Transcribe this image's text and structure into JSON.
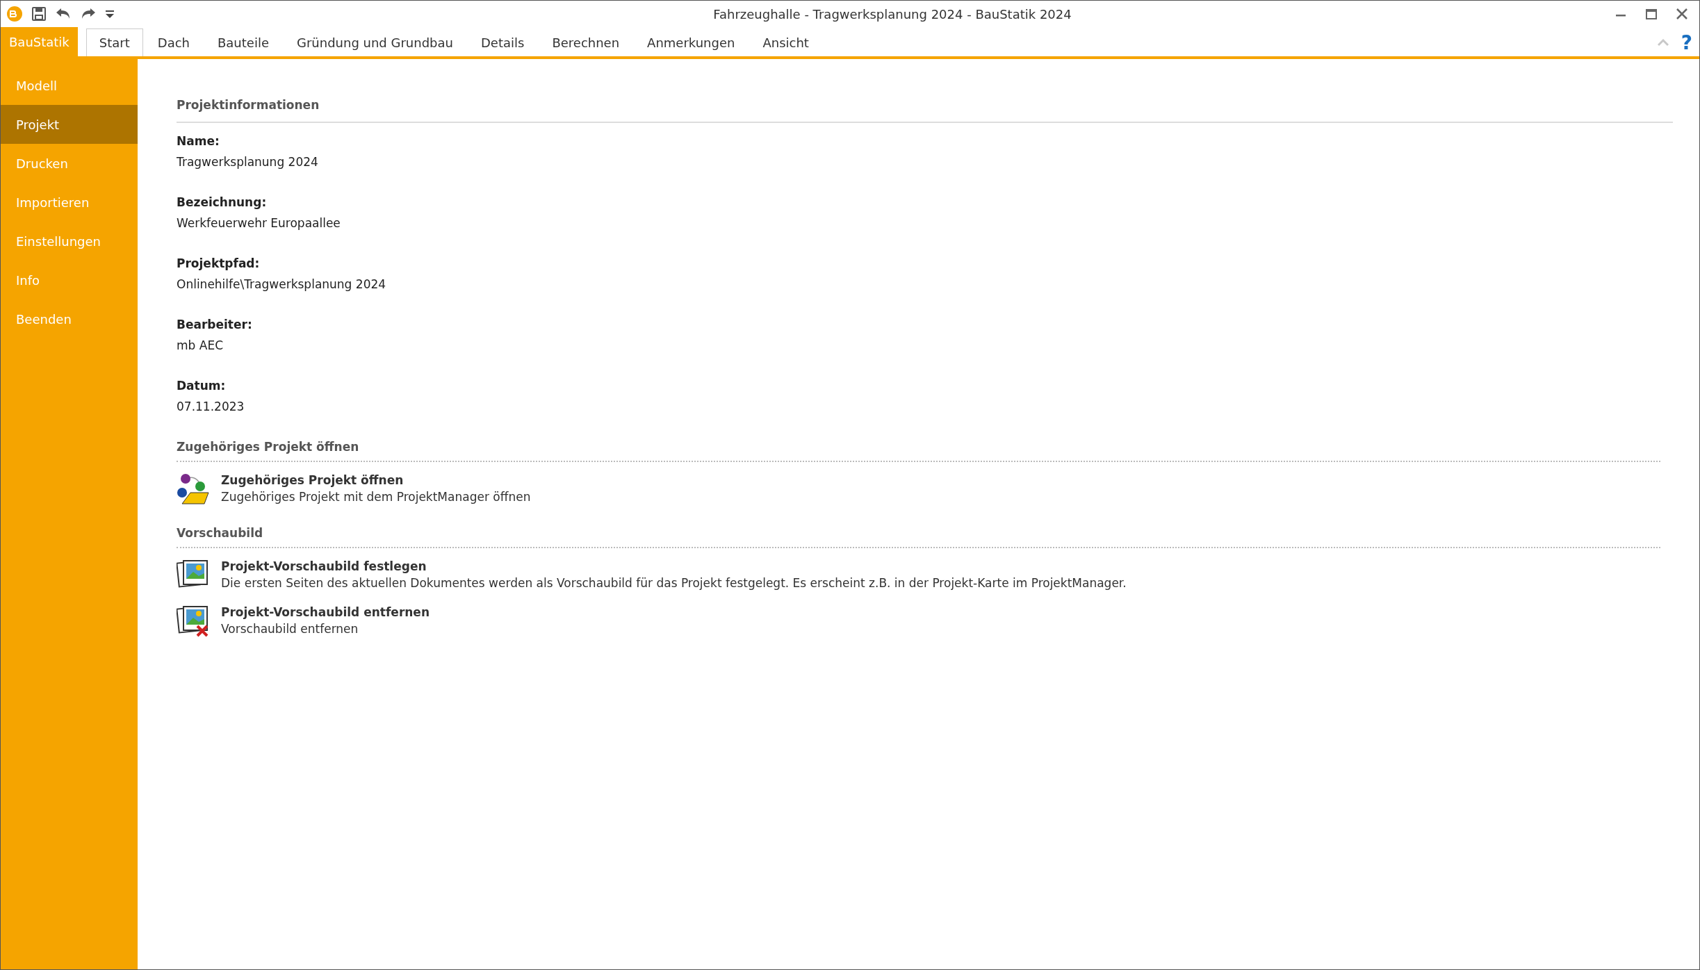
{
  "window": {
    "title": "Fahrzeughalle - Tragwerksplanung 2024 - BauStatik 2024"
  },
  "app_button": "BauStatik",
  "tabs": [
    {
      "label": "Start",
      "selected": true
    },
    {
      "label": "Dach",
      "selected": false
    },
    {
      "label": "Bauteile",
      "selected": false
    },
    {
      "label": "Gründung und Grundbau",
      "selected": false
    },
    {
      "label": "Details",
      "selected": false
    },
    {
      "label": "Berechnen",
      "selected": false
    },
    {
      "label": "Anmerkungen",
      "selected": false
    },
    {
      "label": "Ansicht",
      "selected": false
    }
  ],
  "help": "?",
  "sidebar": {
    "items": [
      {
        "label": "Modell",
        "selected": false
      },
      {
        "label": "Projekt",
        "selected": true
      },
      {
        "label": "Drucken",
        "selected": false
      },
      {
        "label": "Importieren",
        "selected": false
      },
      {
        "label": "Einstellungen",
        "selected": false
      },
      {
        "label": "Info",
        "selected": false
      },
      {
        "label": "Beenden",
        "selected": false
      }
    ]
  },
  "project_info": {
    "heading": "Projektinformationen",
    "fields": [
      {
        "label": "Name:",
        "value": "Tragwerksplanung 2024"
      },
      {
        "label": "Bezeichnung:",
        "value": "Werkfeuerwehr Europaallee"
      },
      {
        "label": "Projektpfad:",
        "value": "Onlinehilfe\\Tragwerksplanung 2024"
      },
      {
        "label": "Bearbeiter:",
        "value": "mb AEC"
      },
      {
        "label": "Datum:",
        "value": "07.11.2023"
      }
    ]
  },
  "sections": [
    {
      "heading": "Zugehöriges Projekt öffnen",
      "actions": [
        {
          "kind": "project",
          "title": "Zugehöriges Projekt öffnen",
          "description": "Zugehöriges Projekt mit dem ProjektManager öffnen"
        }
      ]
    },
    {
      "heading": "Vorschaubild",
      "actions": [
        {
          "kind": "preview",
          "title": "Projekt-Vorschaubild festlegen",
          "description": "Die ersten Seiten des aktuellen Dokumentes werden als Vorschaubild für das Projekt festgelegt. Es erscheint z.B. in der Projekt-Karte im ProjektManager."
        },
        {
          "kind": "preview-remove",
          "title": "Projekt-Vorschaubild entfernen",
          "description": "Vorschaubild entfernen"
        }
      ]
    }
  ]
}
